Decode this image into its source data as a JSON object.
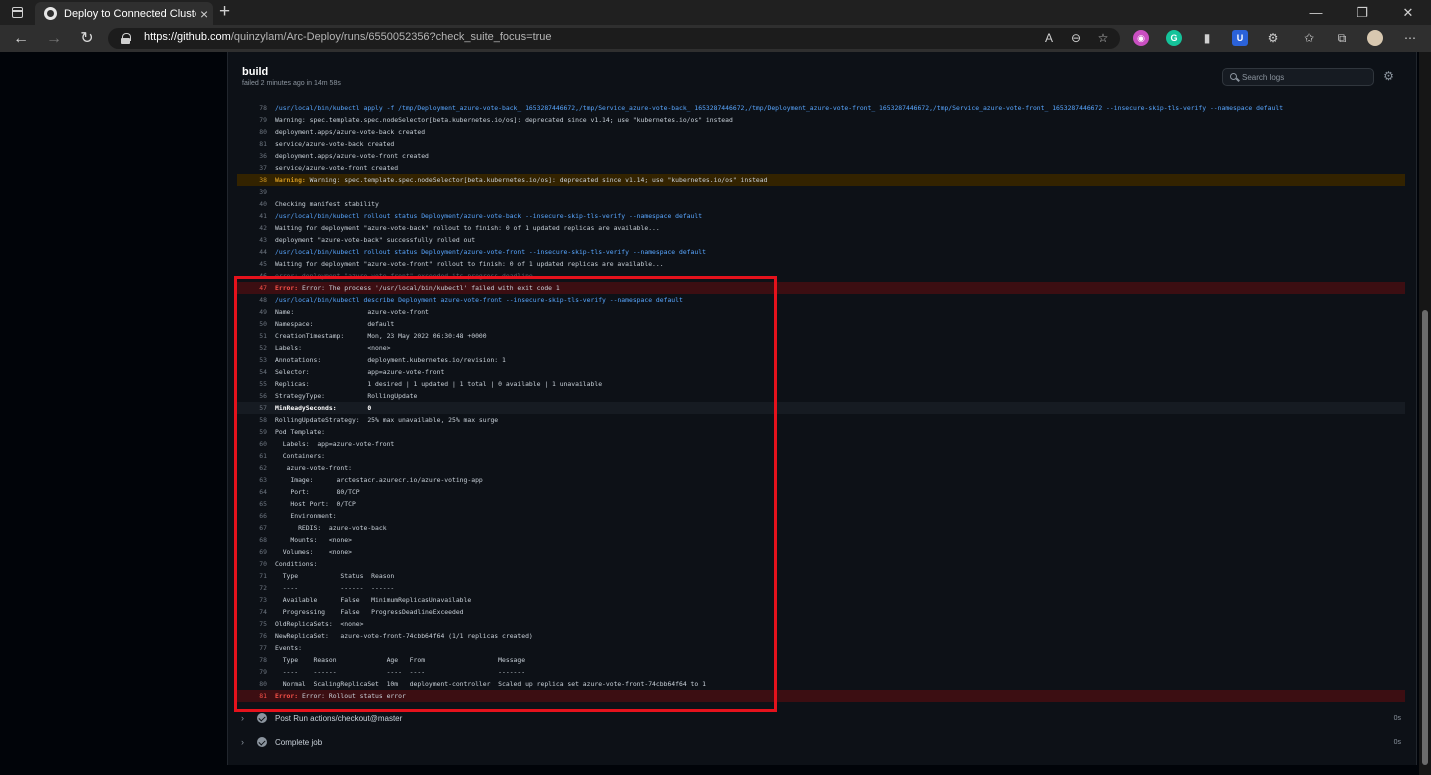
{
  "browser": {
    "tab_title": "Deploy to Connected Cluster · qu",
    "tab_close": "×",
    "new_tab": "+",
    "url_host": "https://github.com",
    "url_path": "/quinzylam/Arc-Deploy/runs/6550052356?check_suite_focus=true",
    "controls": {
      "minimize": "—",
      "maximize": "❐",
      "close": "✕"
    },
    "nav": {
      "back": "←",
      "forward": "→",
      "refresh": "↻"
    },
    "toolbar_icons": {
      "read_aloud": "A",
      "zoom": "⊖",
      "favorite_add": "☆",
      "ext1": "◉",
      "ext2": "G",
      "ext3": "▮",
      "ext4": "U",
      "extensions": "⚙",
      "favorites": "✩",
      "collections": "⧉",
      "menu": "⋯"
    }
  },
  "job": {
    "title": "build",
    "subtitle": "failed 2 minutes ago in 14m 58s",
    "search_placeholder": "Search logs",
    "gear": "⚙"
  },
  "log_lines": [
    {
      "n": "78",
      "t": "/usr/local/bin/kubectl apply -f /tmp/Deployment_azure-vote-back_ 1653287446672,/tmp/Service_azure-vote-back_ 1653287446672,/tmp/Deployment_azure-vote-front_ 1653287446672,/tmp/Service_azure-vote-front_ 1653287446672 --insecure-skip-tls-verify --namespace default",
      "k": "cmd"
    },
    {
      "n": "79",
      "t": "Warning: spec.template.spec.nodeSelector[beta.kubernetes.io/os]: deprecated since v1.14; use \"kubernetes.io/os\" instead",
      "k": ""
    },
    {
      "n": "80",
      "t": "deployment.apps/azure-vote-back created",
      "k": ""
    },
    {
      "n": "81",
      "t": "service/azure-vote-back created",
      "k": ""
    },
    {
      "n": "36",
      "t": "deployment.apps/azure-vote-front created",
      "k": ""
    },
    {
      "n": "37",
      "t": "service/azure-vote-front created",
      "k": ""
    },
    {
      "n": "38",
      "tag": "Warning:",
      "t": " Warning: spec.template.spec.nodeSelector[beta.kubernetes.io/os]: deprecated since v1.14; use \"kubernetes.io/os\" instead",
      "k": "warn"
    },
    {
      "n": "39",
      "t": "",
      "k": ""
    },
    {
      "n": "40",
      "t": "Checking manifest stability",
      "k": ""
    },
    {
      "n": "41",
      "t": "/usr/local/bin/kubectl rollout status Deployment/azure-vote-back --insecure-skip-tls-verify --namespace default",
      "k": "cmd"
    },
    {
      "n": "42",
      "t": "Waiting for deployment \"azure-vote-back\" rollout to finish: 0 of 1 updated replicas are available...",
      "k": ""
    },
    {
      "n": "43",
      "t": "deployment \"azure-vote-back\" successfully rolled out",
      "k": ""
    },
    {
      "n": "44",
      "t": "/usr/local/bin/kubectl rollout status Deployment/azure-vote-front --insecure-skip-tls-verify --namespace default",
      "k": "cmd"
    },
    {
      "n": "45",
      "t": "Waiting for deployment \"azure-vote-front\" rollout to finish: 0 of 1 updated replicas are available...",
      "k": ""
    },
    {
      "n": "46",
      "t": "error: deployment \"azure-vote-front\" exceeded its progress deadline",
      "k": "partial"
    },
    {
      "n": "47",
      "tag": "Error:",
      "t": " Error: The process '/usr/local/bin/kubectl' failed with exit code 1",
      "k": "err"
    },
    {
      "n": "48",
      "t": "/usr/local/bin/kubectl describe Deployment azure-vote-front --insecure-skip-tls-verify --namespace default",
      "k": "cmd"
    },
    {
      "n": "49",
      "t": "Name:                   azure-vote-front",
      "k": ""
    },
    {
      "n": "50",
      "t": "Namespace:              default",
      "k": ""
    },
    {
      "n": "51",
      "t": "CreationTimestamp:      Mon, 23 May 2022 06:30:48 +0000",
      "k": ""
    },
    {
      "n": "52",
      "t": "Labels:                 <none>",
      "k": ""
    },
    {
      "n": "53",
      "t": "Annotations:            deployment.kubernetes.io/revision: 1",
      "k": ""
    },
    {
      "n": "54",
      "t": "Selector:               app=azure-vote-front",
      "k": ""
    },
    {
      "n": "55",
      "t": "Replicas:               1 desired | 1 updated | 1 total | 0 available | 1 unavailable",
      "k": ""
    },
    {
      "n": "56",
      "t": "StrategyType:           RollingUpdate",
      "k": ""
    },
    {
      "n": "57",
      "t": "MinReadySeconds:        0",
      "k": "hl"
    },
    {
      "n": "58",
      "t": "RollingUpdateStrategy:  25% max unavailable, 25% max surge",
      "k": ""
    },
    {
      "n": "59",
      "t": "Pod Template:",
      "k": ""
    },
    {
      "n": "60",
      "t": "  Labels:  app=azure-vote-front",
      "k": ""
    },
    {
      "n": "61",
      "t": "  Containers:",
      "k": ""
    },
    {
      "n": "62",
      "t": "   azure-vote-front:",
      "k": ""
    },
    {
      "n": "63",
      "t": "    Image:      arctestacr.azurecr.io/azure-voting-app",
      "k": ""
    },
    {
      "n": "64",
      "t": "    Port:       80/TCP",
      "k": ""
    },
    {
      "n": "65",
      "t": "    Host Port:  0/TCP",
      "k": ""
    },
    {
      "n": "66",
      "t": "    Environment:",
      "k": ""
    },
    {
      "n": "67",
      "t": "      REDIS:  azure-vote-back",
      "k": ""
    },
    {
      "n": "68",
      "t": "    Mounts:   <none>",
      "k": ""
    },
    {
      "n": "69",
      "t": "  Volumes:    <none>",
      "k": ""
    },
    {
      "n": "70",
      "t": "Conditions:",
      "k": ""
    },
    {
      "n": "71",
      "t": "  Type           Status  Reason",
      "k": ""
    },
    {
      "n": "72",
      "t": "  ----           ------  ------",
      "k": ""
    },
    {
      "n": "73",
      "t": "  Available      False   MinimumReplicasUnavailable",
      "k": ""
    },
    {
      "n": "74",
      "t": "  Progressing    False   ProgressDeadlineExceeded",
      "k": ""
    },
    {
      "n": "75",
      "t": "OldReplicaSets:  <none>",
      "k": ""
    },
    {
      "n": "76",
      "t": "NewReplicaSet:   azure-vote-front-74cbb64f64 (1/1 replicas created)",
      "k": ""
    },
    {
      "n": "77",
      "t": "Events:",
      "k": ""
    },
    {
      "n": "78",
      "t": "  Type    Reason             Age   From                   Message",
      "k": ""
    },
    {
      "n": "79",
      "t": "  ----    ------             ----  ----                   -------",
      "k": ""
    },
    {
      "n": "80",
      "t": "  Normal  ScalingReplicaSet  10m   deployment-controller  Scaled up replica set azure-vote-front-74cbb64f64 to 1",
      "k": ""
    },
    {
      "n": "81",
      "tag": "Error:",
      "t": " Error: Rollout status error",
      "k": "err"
    }
  ],
  "steps": [
    {
      "label": "Post Run actions/checkout@master",
      "time": "0s"
    },
    {
      "label": "Complete job",
      "time": "0s"
    }
  ],
  "glyphs": {
    "chevron": "›"
  }
}
